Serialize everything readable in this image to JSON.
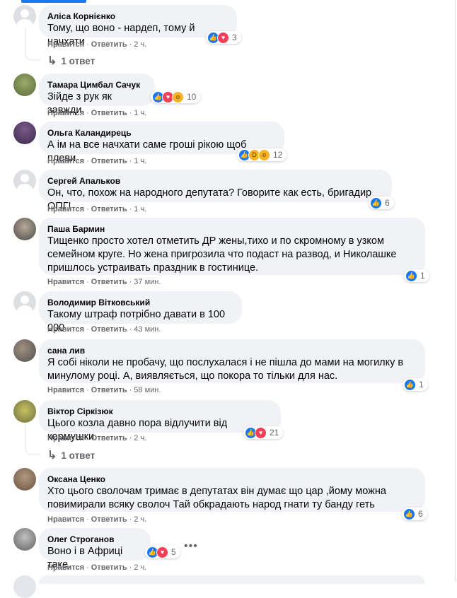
{
  "labels": {
    "like": "Нравится",
    "reply": "Ответить"
  },
  "comments": [
    {
      "author": "Аліса Корнієнко",
      "text": "Тому, що воно - нардеп, тому й начхати",
      "reactions": [
        "like",
        "love"
      ],
      "count": "3",
      "time": "2 ч.",
      "replies": "1 ответ"
    },
    {
      "author": "Тамара Цимбал Сачук",
      "text": "Зійде з рук як завжди.",
      "reactions": [
        "like",
        "love",
        "wow"
      ],
      "count": "10",
      "time": "1 ч."
    },
    {
      "author": "Ольга Каландирець",
      "text": "А ім на все начхати саме гроші рікою щоб плеви",
      "reactions": [
        "like",
        "haha",
        "wow"
      ],
      "count": "12",
      "time": "1 ч."
    },
    {
      "author": "Сергей Апальков",
      "text": "Он, что, похож на народного депутата? Говорите как есть, бригадир ОПГ!",
      "reactions": [
        "like"
      ],
      "count": "6",
      "time": "1 ч."
    },
    {
      "author": "Паша Бармин",
      "text": "Тищенко просто хотел отметить ДР жены,тихо и по скромному в узком\nсемейном круге. Но жена пригрозила что подаст на развод, и Николашке\nпришлось устраивать праздник в гостинице.",
      "reactions": [
        "like"
      ],
      "count": "1",
      "time": "37 мин."
    },
    {
      "author": "Володимир Вітковський",
      "text": "Такому штраф потрібно давати в 100 000",
      "reactions": [],
      "count": "",
      "time": "43 мин."
    },
    {
      "author": "сана лив",
      "text": "Я собі ніколи не пробачу, що послухалася і не пішла до мами на могилку в\nминулому році. А, виявляється, що покора то тільки для нас.",
      "reactions": [
        "like"
      ],
      "count": "1",
      "time": "58 мин."
    },
    {
      "author": "Віктор Сіркізюк",
      "text": "Цього козла давно пора відлучити від кормушки.",
      "reactions": [
        "like",
        "love"
      ],
      "count": "21",
      "time": "2 ч.",
      "replies": "1 ответ"
    },
    {
      "author": "Оксана Ценко",
      "text": "Хто цього сволочам тримає в депутатах він думає що цар ,йому можна\nповимирали всяку сволоч Тай обкрадають народ гнати ту банду геть",
      "reactions": [
        "like"
      ],
      "count": "6",
      "time": "2 ч."
    },
    {
      "author": "Олег Строганов",
      "text": "Воно і в Африці таке.",
      "reactions": [
        "like",
        "love"
      ],
      "count": "5",
      "time": "2 ч."
    }
  ],
  "icons": {
    "like": "thumbs-up-icon",
    "love": "heart-icon",
    "wow": "wow-face-icon",
    "haha": "haha-face-icon",
    "replies": "reply-arrow-icon",
    "more": "more-options-icon"
  },
  "colors": {
    "accent": "#1877f2",
    "bubble": "#f0f2f5",
    "muted": "#65676b",
    "love": "#f33e58",
    "wow": "#f7b125"
  }
}
